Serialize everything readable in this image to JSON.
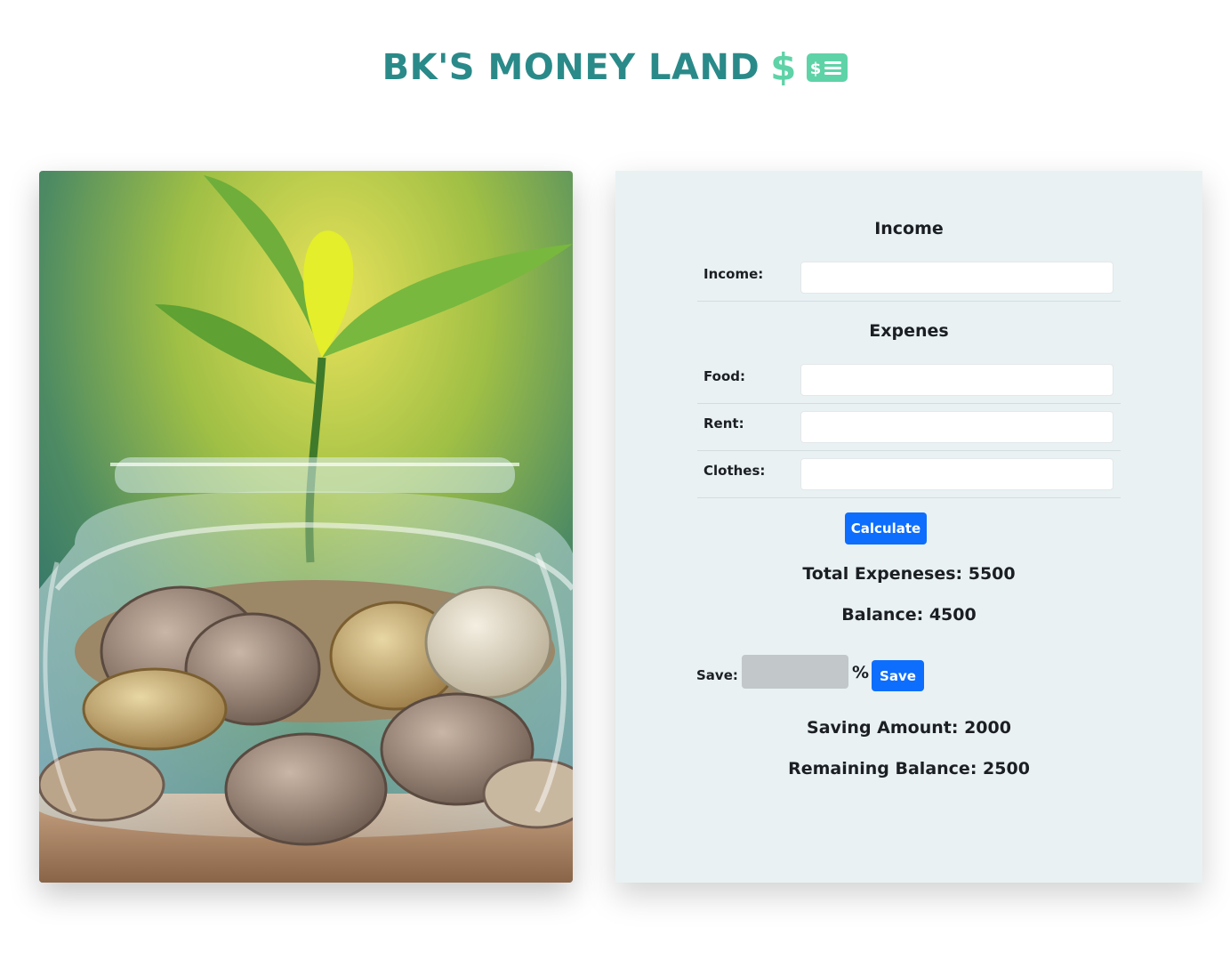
{
  "header": {
    "title": "BK'S MONEY LAND",
    "dollar_glyph": "$",
    "bill_glyph": "$",
    "accent_color": "#2a8a89",
    "icon_color": "#5fd3a8"
  },
  "photo": {
    "icon": "coin-jar-plant-photo"
  },
  "income_section": {
    "title": "Income",
    "income_label": "Income:",
    "income_value": ""
  },
  "expenses_section": {
    "title": "Expenes",
    "food_label": "Food:",
    "food_value": "",
    "rent_label": "Rent:",
    "rent_value": "",
    "clothes_label": "Clothes:",
    "clothes_value": ""
  },
  "calculate_button": "Calculate",
  "results": {
    "total_expenses": "Total Expeneses: 5500",
    "balance": "Balance: 4500"
  },
  "save_section": {
    "label": "Save:",
    "value": "",
    "percent_sign": "%",
    "button": "Save"
  },
  "savings": {
    "saving_amount": "Saving Amount: 2000",
    "remaining_balance": "Remaining Balance: 2500"
  },
  "colors": {
    "button_blue": "#0d6efd",
    "panel_bg": "#e9f1f3"
  }
}
